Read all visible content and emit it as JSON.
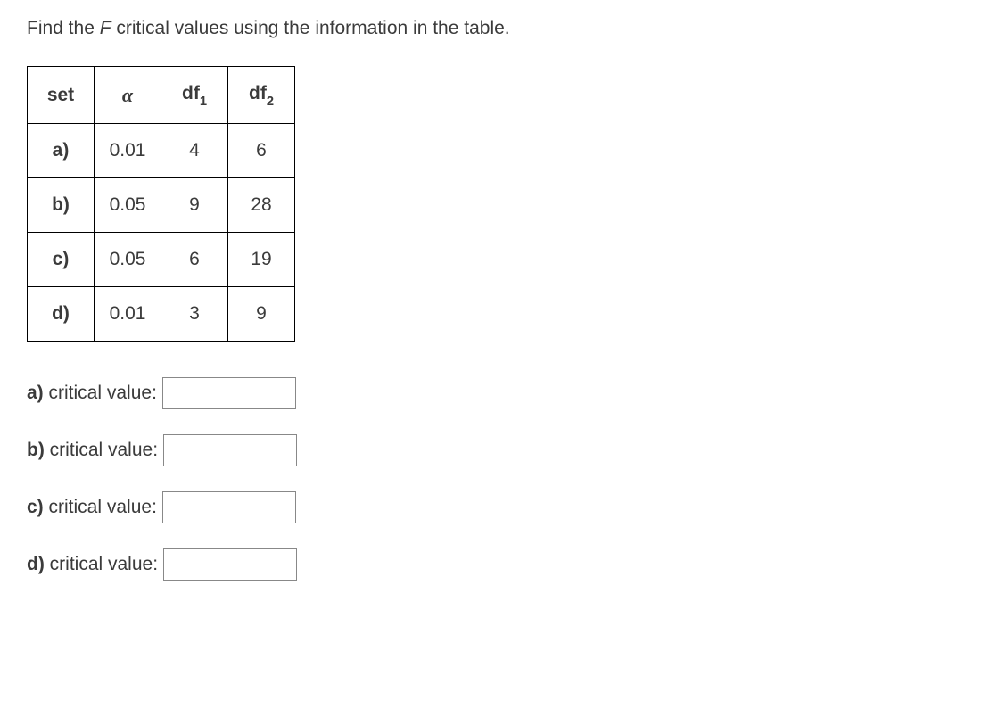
{
  "instruction": {
    "pre": "Find the ",
    "var": "F",
    "post": " critical values using the information in the table."
  },
  "table": {
    "headers": {
      "set": "set",
      "alpha": "α",
      "df1_base": "df",
      "df1_sub": "1",
      "df2_base": "df",
      "df2_sub": "2"
    },
    "rows": [
      {
        "set": "a)",
        "alpha": "0.01",
        "df1": "4",
        "df2": "6"
      },
      {
        "set": "b)",
        "alpha": "0.05",
        "df1": "9",
        "df2": "28"
      },
      {
        "set": "c)",
        "alpha": "0.05",
        "df1": "6",
        "df2": "19"
      },
      {
        "set": "d)",
        "alpha": "0.01",
        "df1": "3",
        "df2": "9"
      }
    ]
  },
  "answers": [
    {
      "key": "a)",
      "label": " critical value: ",
      "value": ""
    },
    {
      "key": "b)",
      "label": " critical value: ",
      "value": ""
    },
    {
      "key": "c)",
      "label": " critical value: ",
      "value": ""
    },
    {
      "key": "d)",
      "label": " critical value: ",
      "value": ""
    }
  ]
}
